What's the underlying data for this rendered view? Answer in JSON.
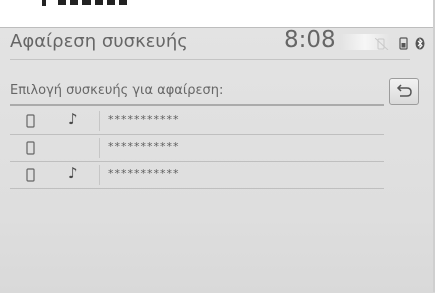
{
  "header": {
    "title": "Αφαίρεση συσκευής",
    "clock": "8:08",
    "status_icons": [
      "phone-mute-icon",
      "phone-battery-icon",
      "bluetooth-icon"
    ]
  },
  "list": {
    "heading": "Επιλογή συσκευής για αφαίρεση:",
    "back_icon": "return-arrow-icon",
    "devices": [
      {
        "name": "***********",
        "icons": [
          "phone-icon",
          "music-note-icon"
        ]
      },
      {
        "name": "***********",
        "icons": [
          "phone-icon"
        ]
      },
      {
        "name": "***********",
        "icons": [
          "phone-icon",
          "music-note-icon"
        ]
      }
    ],
    "music_glyph": "♪"
  },
  "colors": {
    "screen_bg": "#e1e1e1",
    "text": "#666666",
    "line": "#ababab"
  }
}
